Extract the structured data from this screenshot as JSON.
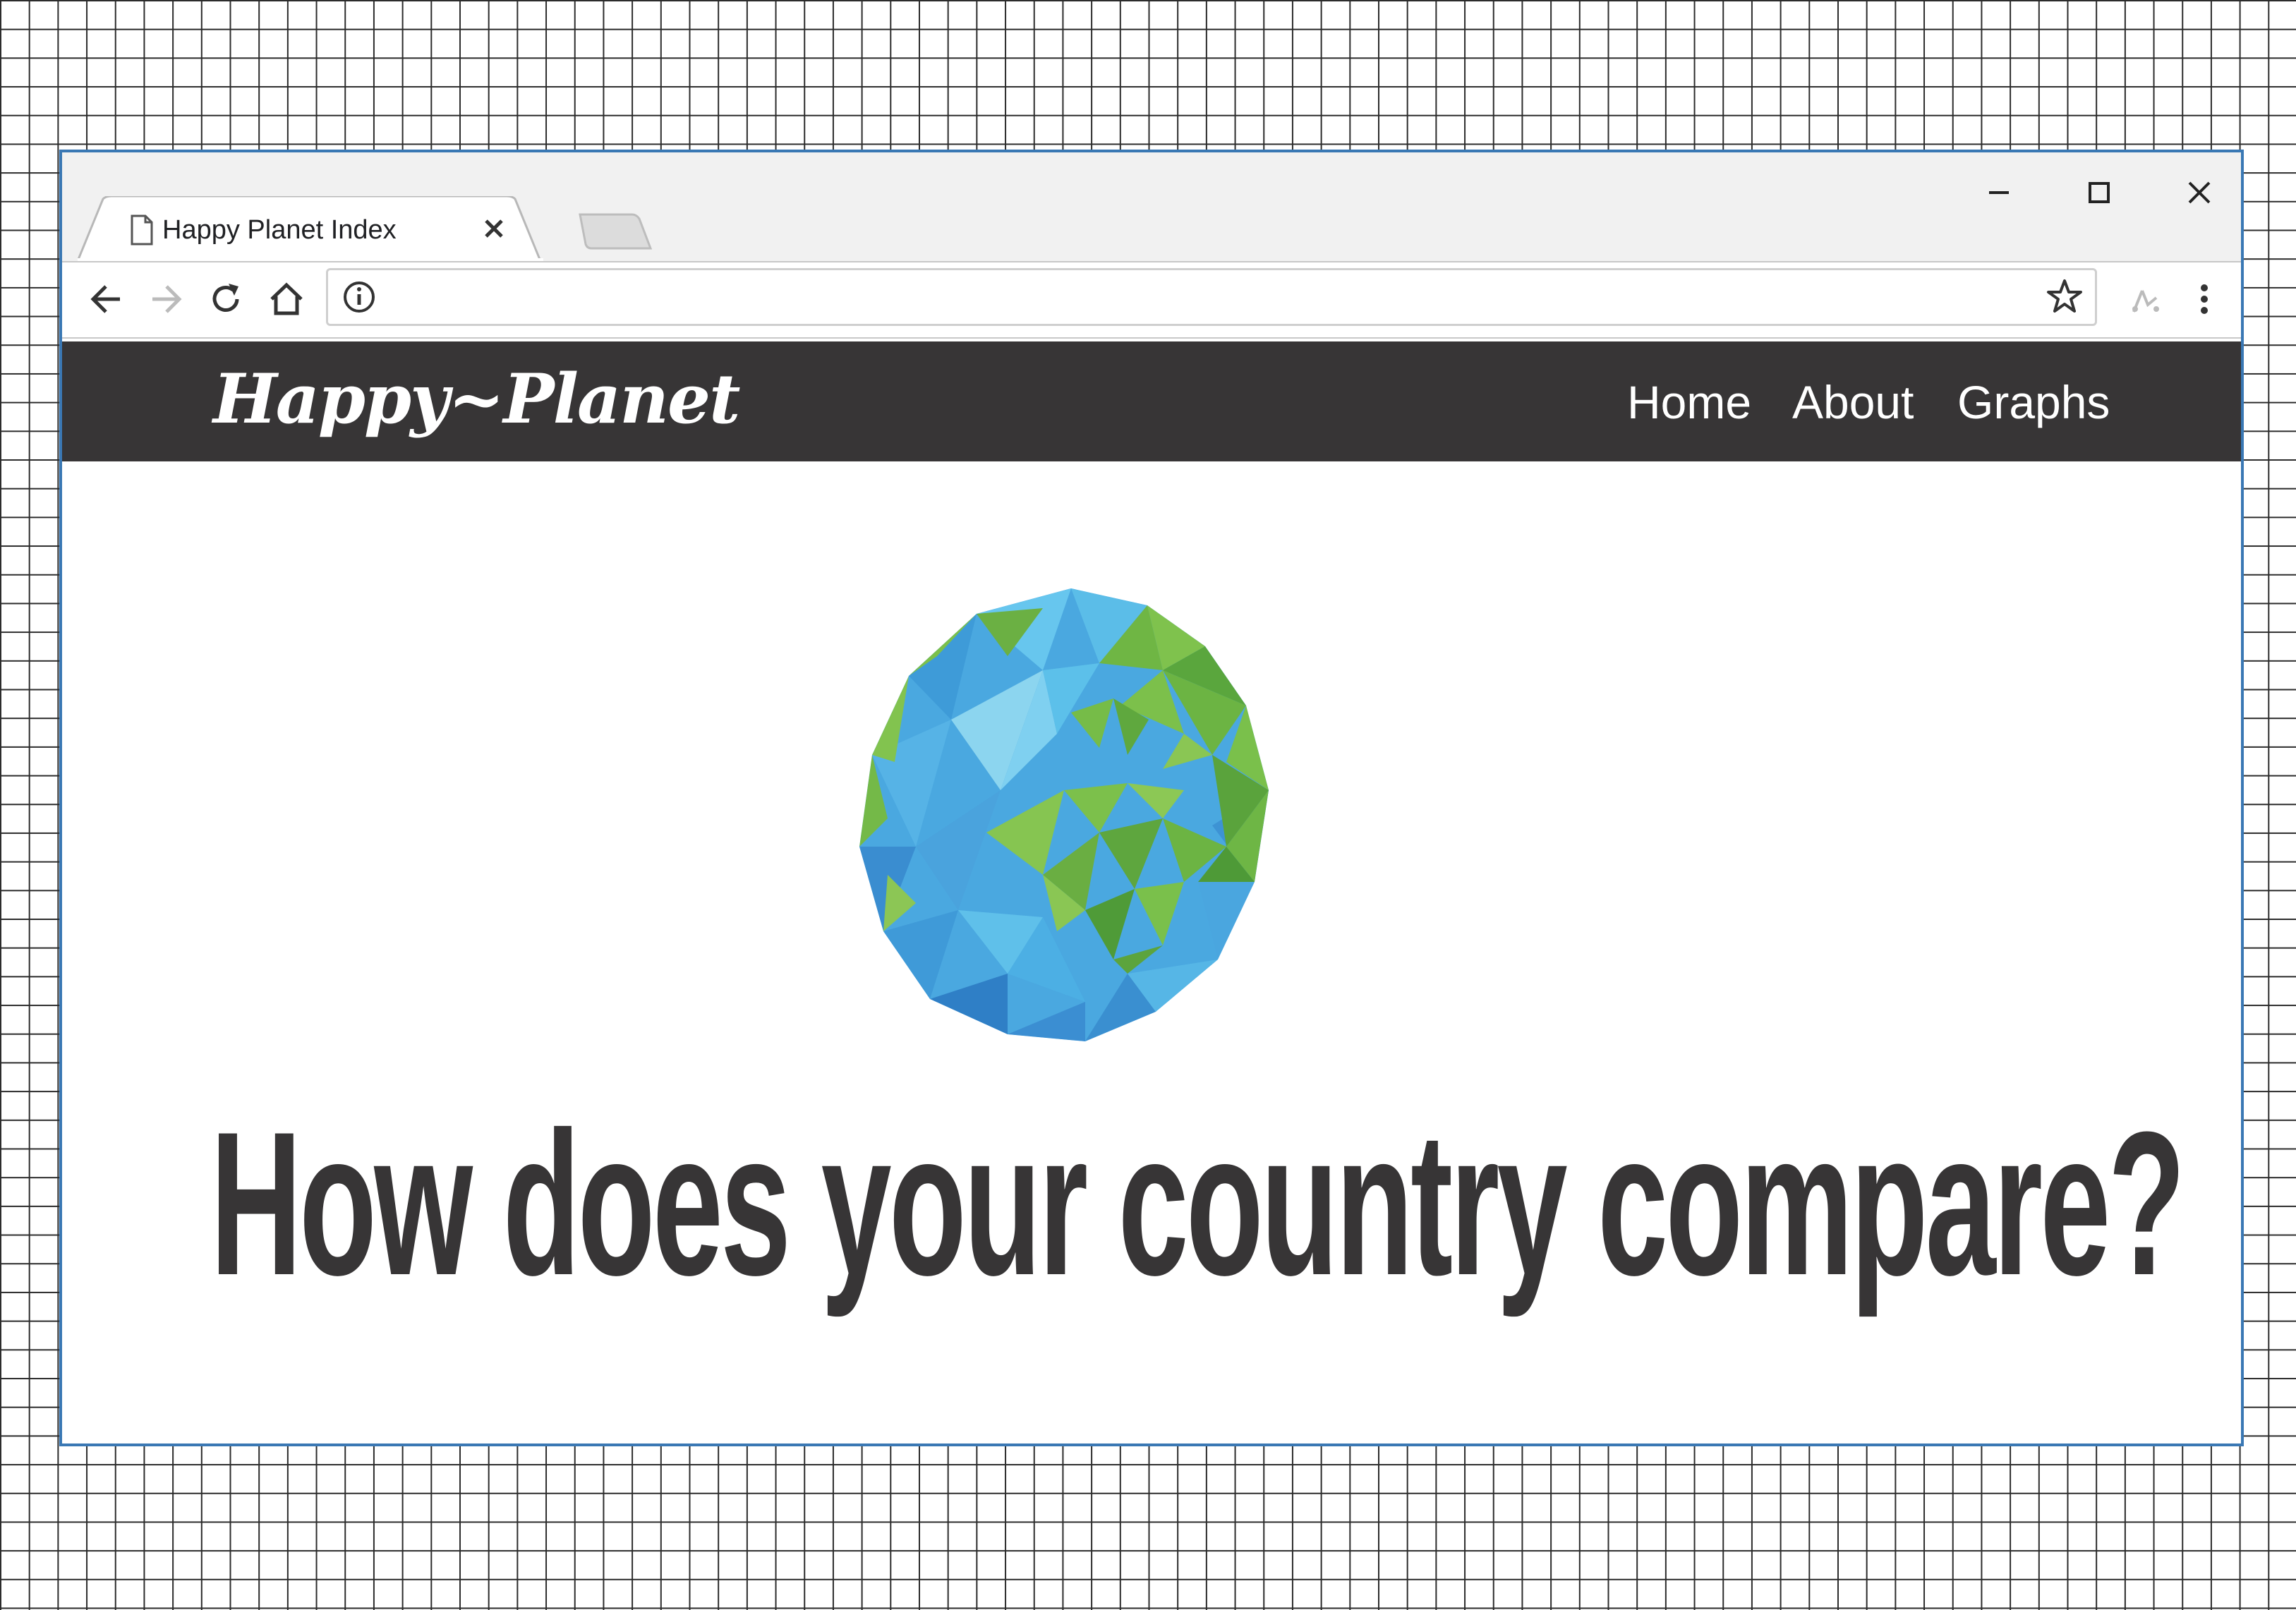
{
  "browser": {
    "tab_title": "Happy Planet Index",
    "address_url": "",
    "window_controls": {
      "minimize": "minimize-icon",
      "maximize": "maximize-icon",
      "close": "close-icon"
    },
    "toolbar_icons": [
      "back-arrow-icon",
      "forward-arrow-icon",
      "reload-icon",
      "home-icon",
      "info-icon",
      "bookmark-star-icon",
      "extension-icon",
      "menu-kebab-icon"
    ]
  },
  "site": {
    "logo": "Happy~Planet",
    "nav": [
      "Home",
      "About",
      "Graphs"
    ],
    "hero_image": "low-poly-globe-image",
    "headline": "How does your country compare?"
  },
  "colors": {
    "navbar_bg": "#373536",
    "headline": "#373536",
    "globe_blue": "#4aa8e0",
    "globe_green": "#7cc04b",
    "window_border": "#3a78b4"
  }
}
